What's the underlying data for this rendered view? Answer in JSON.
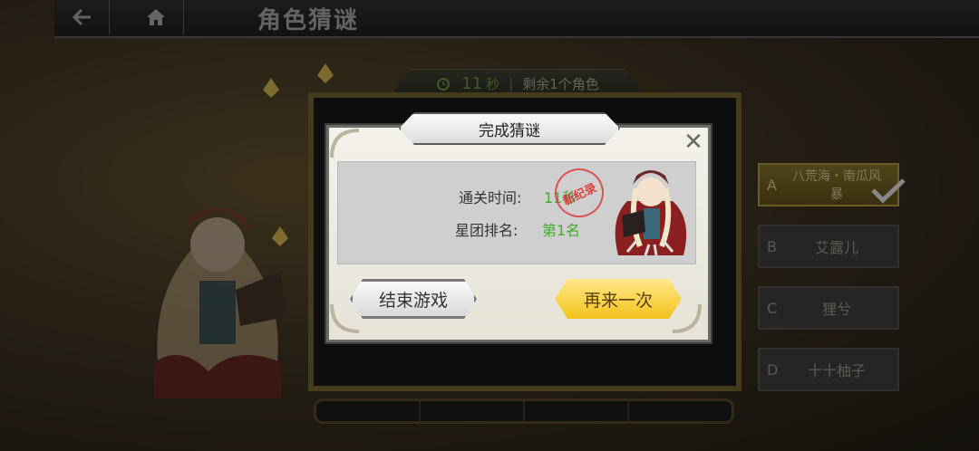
{
  "header": {
    "back_icon": "back-arrow-icon",
    "home_icon": "home-icon",
    "title": "角色猜谜"
  },
  "timer": {
    "icon": "clock-icon",
    "seconds": "11",
    "unit": "秒",
    "remaining": "剩余1个角色"
  },
  "options": [
    {
      "letter": "A",
      "name": "八荒海・南瓜风暴",
      "selected": true
    },
    {
      "letter": "B",
      "name": "艾露儿",
      "selected": false
    },
    {
      "letter": "C",
      "name": "狸兮",
      "selected": false
    },
    {
      "letter": "D",
      "name": "十十柚子",
      "selected": false
    }
  ],
  "dialog": {
    "title": "完成猜谜",
    "clear_time_label": "通关时间:",
    "clear_time_value": "11秒",
    "rank_label": "星团排名:",
    "rank_value": "第1名",
    "stamp_text": "新纪录",
    "end_button": "结束游戏",
    "retry_button": "再来一次"
  },
  "colors": {
    "accent_green": "#3fae2a",
    "retry_yellow": "#f2c21a",
    "gold_border": "#6b5a2a"
  }
}
